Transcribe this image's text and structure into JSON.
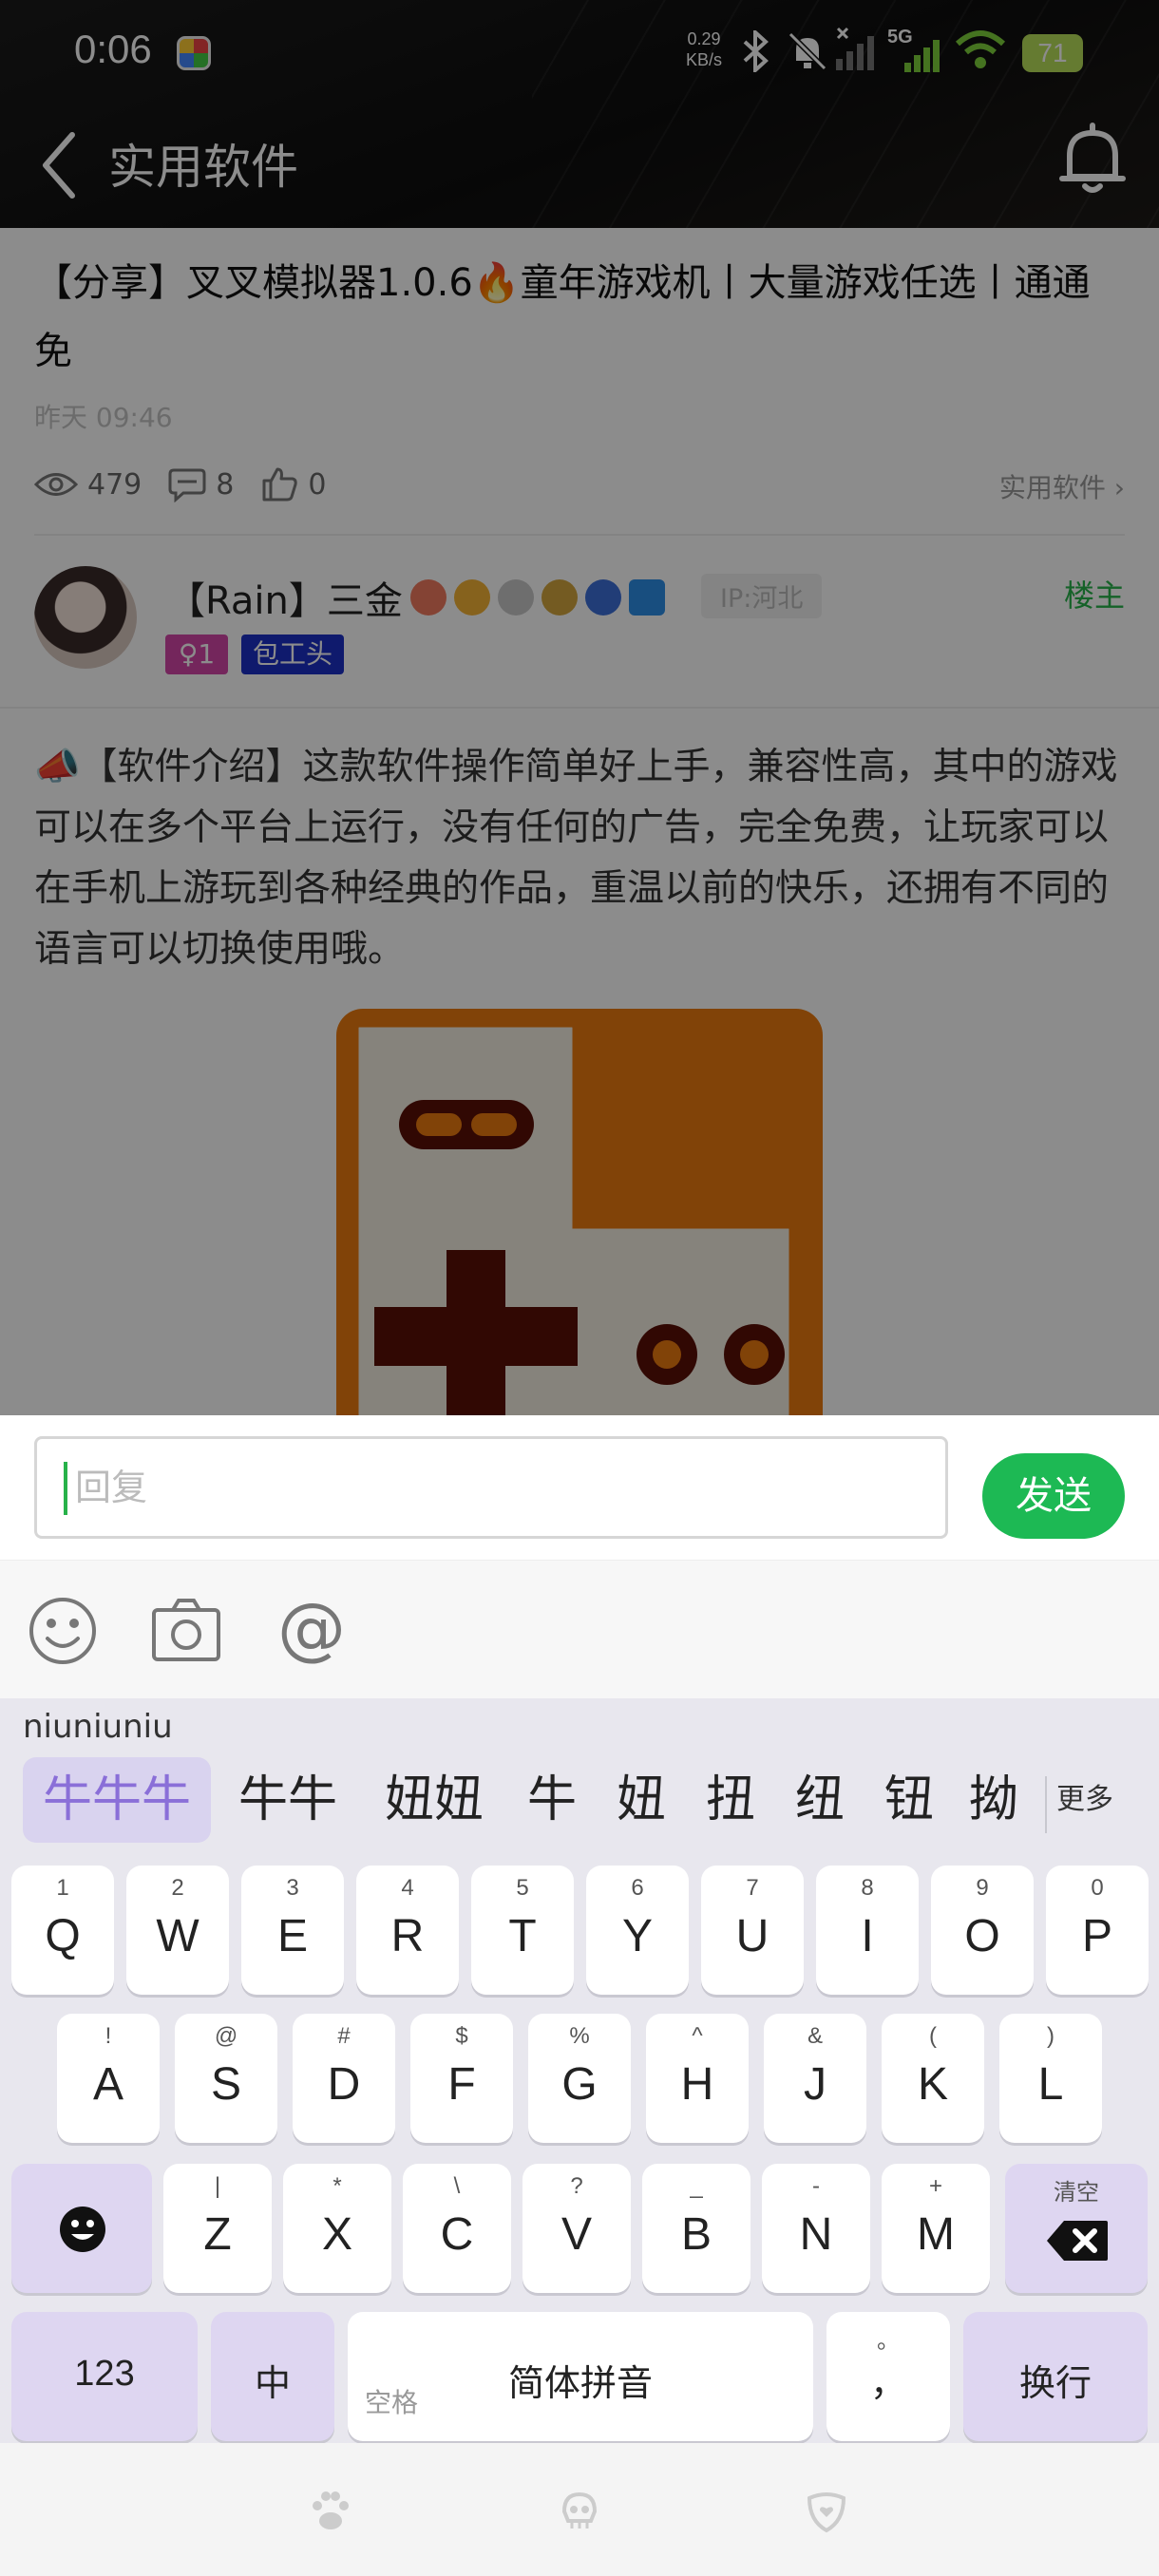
{
  "status": {
    "time": "0:06",
    "speed_value": "0.29",
    "speed_unit": "KB/s",
    "network": "5G",
    "battery": "71"
  },
  "nav": {
    "title": "实用软件"
  },
  "post": {
    "title": "【分享】叉叉模拟器1.0.6🔥童年游戏机丨大量游戏任选丨通通免",
    "time": "昨天 09:46",
    "views": "479",
    "comments": "8",
    "likes": "0",
    "category": "实用软件",
    "author": "【Rain】三金",
    "ip": "IP:河北",
    "owner_label": "楼主",
    "gender_tag": "♀1",
    "title_tag": "包工头",
    "body": "📣【软件介绍】这款软件操作简单好上手，兼容性高，其中的游戏可以在多个平台上运行，没有任何的广告，完全免费，让玩家可以在手机上游玩到各种经典的作品，重温以前的快乐，还拥有不同的语言可以切换使用哦。"
  },
  "reply": {
    "placeholder": "回复",
    "send_label": "发送"
  },
  "keyboard": {
    "pinyin": "niuniuniu",
    "candidates": [
      "牛牛牛",
      "牛牛",
      "妞妞",
      "牛",
      "妞",
      "扭",
      "纽",
      "钮",
      "拗"
    ],
    "more_label": "更多",
    "row1": [
      {
        "k": "Q",
        "s": "1"
      },
      {
        "k": "W",
        "s": "2"
      },
      {
        "k": "E",
        "s": "3"
      },
      {
        "k": "R",
        "s": "4"
      },
      {
        "k": "T",
        "s": "5"
      },
      {
        "k": "Y",
        "s": "6"
      },
      {
        "k": "U",
        "s": "7"
      },
      {
        "k": "I",
        "s": "8"
      },
      {
        "k": "O",
        "s": "9"
      },
      {
        "k": "P",
        "s": "0"
      }
    ],
    "row2": [
      {
        "k": "A",
        "s": "!"
      },
      {
        "k": "S",
        "s": "@"
      },
      {
        "k": "D",
        "s": "#"
      },
      {
        "k": "F",
        "s": "$"
      },
      {
        "k": "G",
        "s": "%"
      },
      {
        "k": "H",
        "s": "^"
      },
      {
        "k": "J",
        "s": "&"
      },
      {
        "k": "K",
        "s": "("
      },
      {
        "k": "L",
        "s": ")"
      }
    ],
    "row3": [
      {
        "k": "Z",
        "s": "|"
      },
      {
        "k": "X",
        "s": "*"
      },
      {
        "k": "C",
        "s": "\\"
      },
      {
        "k": "V",
        "s": "?"
      },
      {
        "k": "B",
        "s": "_"
      },
      {
        "k": "N",
        "s": "-"
      },
      {
        "k": "M",
        "s": "+"
      }
    ],
    "clear_label": "清空",
    "num_label": "123",
    "zh_label": "中",
    "space_hint": "空格",
    "space_label": "简体拼音",
    "comma_label": "，",
    "comma_sub": "。",
    "enter_label": "换行"
  },
  "colors": {
    "accent_green": "#1db954",
    "candidate_purple": "#8a6fd8",
    "tag_pink": "#d446a8",
    "tag_blue": "#1c31c7"
  }
}
